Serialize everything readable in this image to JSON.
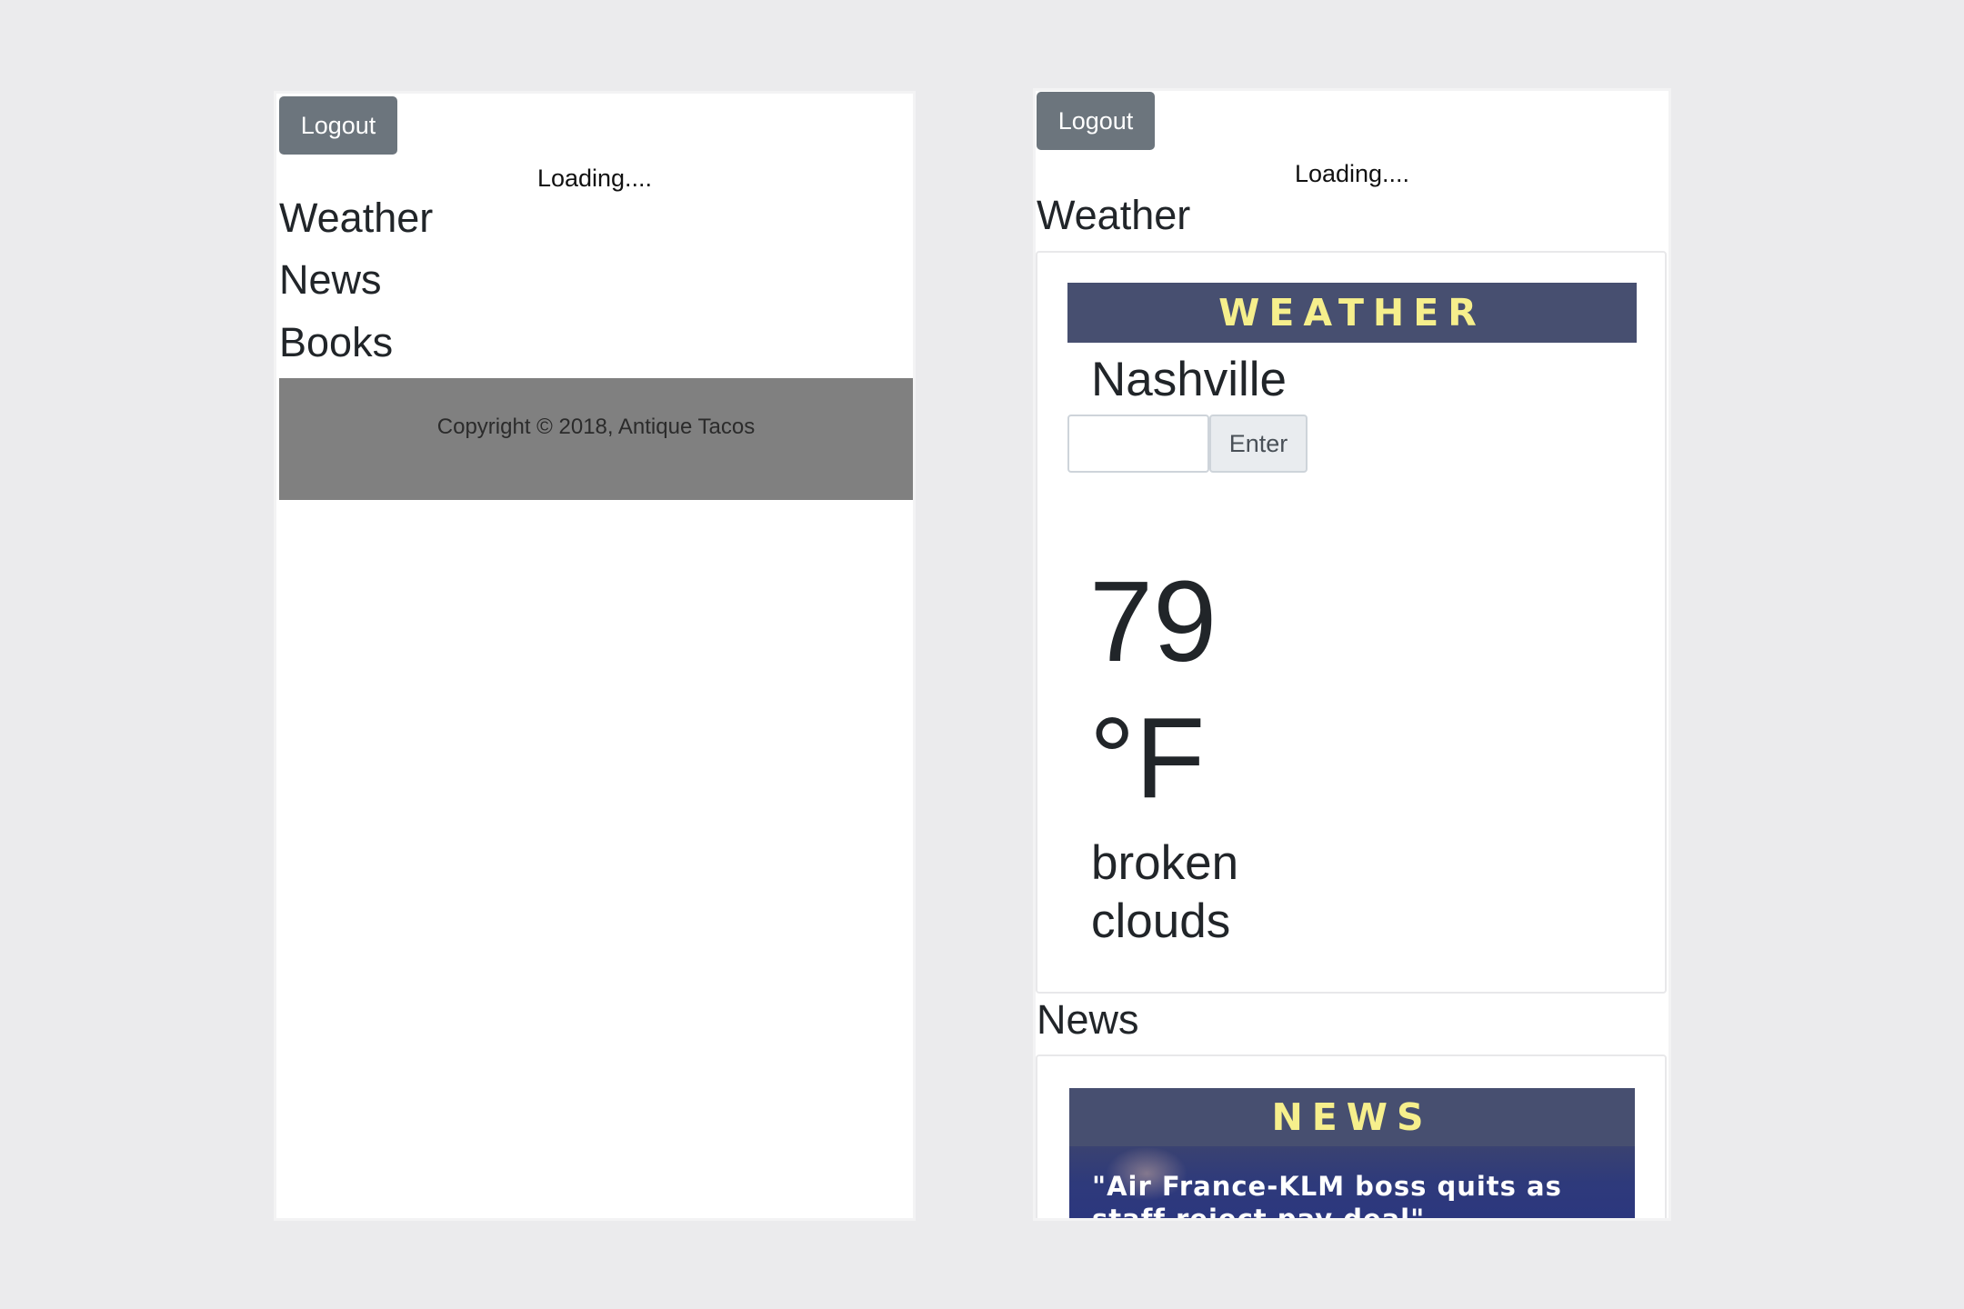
{
  "left_screen": {
    "logout_label": "Logout",
    "loading_text": "Loading....",
    "nav": {
      "weather": "Weather",
      "news": "News",
      "books": "Books"
    },
    "footer_text": "Copyright © 2018, Antique Tacos"
  },
  "right_screen": {
    "logout_label": "Logout",
    "loading_text": "Loading....",
    "weather_section_title": "Weather",
    "weather_widget": {
      "banner": "WEATHER",
      "city": "Nashville",
      "input_value": "",
      "enter_label": "Enter",
      "temperature": "79",
      "unit": "°F",
      "condition": "broken clouds"
    },
    "news_section_title": "News",
    "news_widget": {
      "banner": "NEWS",
      "headline": "\"Air France-KLM boss quits as staff reject pay deal\""
    }
  },
  "colors": {
    "background": "#ebebed",
    "button_gray": "#6c757d",
    "footer_gray": "#808080",
    "banner_navy": "#474f70",
    "banner_text_yellow": "#f6ef8c"
  }
}
